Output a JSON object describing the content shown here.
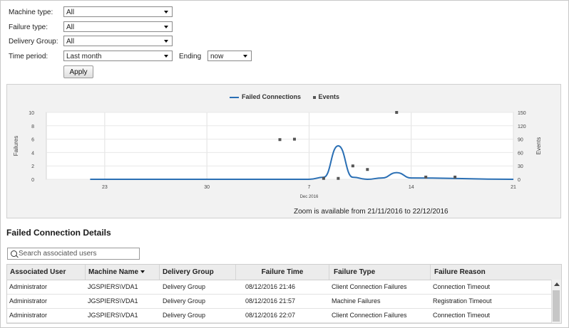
{
  "filters": {
    "machine_type": {
      "label": "Machine type:",
      "value": "All"
    },
    "failure_type": {
      "label": "Failure type:",
      "value": "All"
    },
    "delivery_group": {
      "label": "Delivery Group:",
      "value": "All"
    },
    "time_period": {
      "label": "Time period:",
      "value": "Last month"
    },
    "ending": {
      "label": "Ending",
      "value": "now"
    },
    "apply_label": "Apply"
  },
  "chart_data": {
    "type": "line",
    "legend": [
      "Failed Connections",
      "Events"
    ],
    "legend_placement": "top-center",
    "x_ticks": [
      "23",
      "30",
      "7",
      "14",
      "21"
    ],
    "x_sublabel": "Dec 2016",
    "ylabel": "Failures",
    "ylabel_right": "Events",
    "ylim": [
      0,
      10
    ],
    "y_ticks": [
      0,
      2,
      4,
      6,
      8,
      10
    ],
    "ylim_right": [
      0,
      150
    ],
    "y_ticks_right": [
      0,
      30,
      60,
      90,
      120,
      150
    ],
    "series": [
      {
        "name": "Failed Connections",
        "color": "#2a6fb4",
        "x": [
          "2016-11-22",
          "2016-12-07",
          "2016-12-08",
          "2016-12-09",
          "2016-12-10",
          "2016-12-11",
          "2016-12-12",
          "2016-12-13",
          "2016-12-14",
          "2016-12-21"
        ],
        "values": [
          0,
          0,
          0.3,
          5,
          0.3,
          0,
          0.2,
          1,
          0.2,
          0
        ]
      },
      {
        "name": "Events",
        "color": "#555555",
        "x": [
          "2016-12-05",
          "2016-12-06",
          "2016-12-08",
          "2016-12-09",
          "2016-12-10",
          "2016-12-11",
          "2016-12-13",
          "2016-12-15",
          "2016-12-17"
        ],
        "values": [
          89,
          90,
          2,
          2,
          30,
          22,
          150,
          5,
          5
        ]
      }
    ],
    "grid": true
  },
  "zoom_note": "Zoom is available from 21/11/2016 to 22/12/2016",
  "details": {
    "title": "Failed Connection Details",
    "search_placeholder": "Search associated users",
    "columns": [
      "Associated User",
      "Machine Name",
      "Delivery Group",
      "Failure Time",
      "Failure Type",
      "Failure Reason"
    ],
    "rows": [
      [
        "Administrator",
        "JGSPIERS\\VDA1",
        "Delivery Group",
        "08/12/2016 21:46",
        "Client Connection Failures",
        "Connection Timeout"
      ],
      [
        "Administrator",
        "JGSPIERS\\VDA1",
        "Delivery Group",
        "08/12/2016 21:57",
        "Machine Failures",
        "Registration Timeout"
      ],
      [
        "Administrator",
        "JGSPIERS\\VDA1",
        "Delivery Group",
        "08/12/2016 22:07",
        "Client Connection Failures",
        "Connection Timeout"
      ]
    ]
  }
}
